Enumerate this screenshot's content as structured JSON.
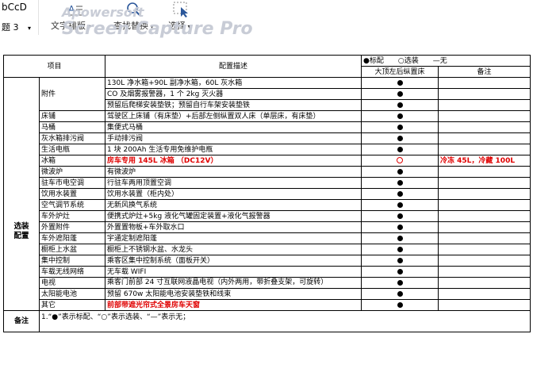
{
  "ribbon": {
    "style_preview": "bCcD",
    "style_name": "题 3",
    "tools": [
      "文字排版",
      "查找替换",
      "选择"
    ]
  },
  "watermark": {
    "line1": "Apowersoft",
    "line2": "Screen Capture Pro"
  },
  "table": {
    "headers": {
      "item": "项目",
      "desc": "配置描述",
      "legend": "●标配　　○选装　　—无",
      "model": "大顶左后纵置床",
      "note": "备注"
    },
    "attachments_label": "附件",
    "attachments": [
      {
        "desc": "130L 净水箱+90L 副净水箱，60L 灰水箱",
        "mark": "std",
        "note": ""
      },
      {
        "desc": "CO 及烟雾报警器，1 个 2kg 灭火器",
        "mark": "std",
        "note": ""
      },
      {
        "desc": "预留后爬梯安装垫铁；预留自行车架安装垫铁",
        "mark": "std",
        "note": ""
      }
    ],
    "group_label": "选装配置",
    "rows": [
      {
        "item": "床铺",
        "desc": "驾驶区上床铺（有床垫）+后部左侧纵置双人床（单层床，有床垫）",
        "mark": "std",
        "note": "",
        "red": false
      },
      {
        "item": "马桶",
        "desc": "集便式马桶",
        "mark": "std",
        "note": "",
        "red": false
      },
      {
        "item": "灰水箱排污阀",
        "desc": "手动排污阀",
        "mark": "std",
        "note": "",
        "red": false
      },
      {
        "item": "生活电瓶",
        "desc": "1 块 200Ah 生活专用免维护电瓶",
        "mark": "std",
        "note": "",
        "red": false
      },
      {
        "item": "冰箱",
        "desc": "房车专用 145L 冰箱 （DC12V）",
        "mark": "opt",
        "note": "冷冻 45L，冷藏 100L",
        "red": true
      },
      {
        "item": "微波炉",
        "desc": "有微波炉",
        "mark": "std",
        "note": "",
        "red": false
      },
      {
        "item": "驻车市电空调",
        "desc": "行驻车两用顶置空调",
        "mark": "std",
        "note": "",
        "red": false
      },
      {
        "item": "饮用水装置",
        "desc": "饮用水装置（柜内处）",
        "mark": "std",
        "note": "",
        "red": false
      },
      {
        "item": "空气调节系统",
        "desc": "无新风换气系统",
        "mark": "std",
        "note": "",
        "red": false
      },
      {
        "item": "车外炉灶",
        "desc": "便携式炉灶+5kg 液化气罐固定装置+液化气报警器",
        "mark": "std",
        "note": "",
        "red": false
      },
      {
        "item": "外置附件",
        "desc": "外置置物板+车外取水口",
        "mark": "std",
        "note": "",
        "red": false
      },
      {
        "item": "车外遮阳蓬",
        "desc": "宇通定制遮阳蓬",
        "mark": "std",
        "note": "",
        "red": false
      },
      {
        "item": "橱柜上水盆",
        "desc": "橱柜上不锈钢水盆、水龙头",
        "mark": "std",
        "note": "",
        "red": false
      },
      {
        "item": "集中控制",
        "desc": "乘客区集中控制系统（面板开关）",
        "mark": "std",
        "note": "",
        "red": false
      },
      {
        "item": "车载无线网络",
        "desc": "无车载 WIFI",
        "mark": "std",
        "note": "",
        "red": false
      },
      {
        "item": "电视",
        "desc": "乘客门前部 24 寸互联网液晶电视（内外两用，带折叠支架，可旋转）",
        "mark": "std",
        "note": "",
        "red": false,
        "tall": true
      },
      {
        "item": "太阳能电池",
        "desc": "预留 670w 太阳能电池安装垫铁和线束",
        "mark": "std",
        "note": "",
        "red": false
      },
      {
        "item": "其它",
        "desc": "前部带遮光帘式全景房车天窗",
        "mark": "std",
        "note": "",
        "red": true
      }
    ],
    "remark_label": "备注",
    "remark_text": "1.“●”表示标配、“○”表示选装、“—”表示无；"
  }
}
